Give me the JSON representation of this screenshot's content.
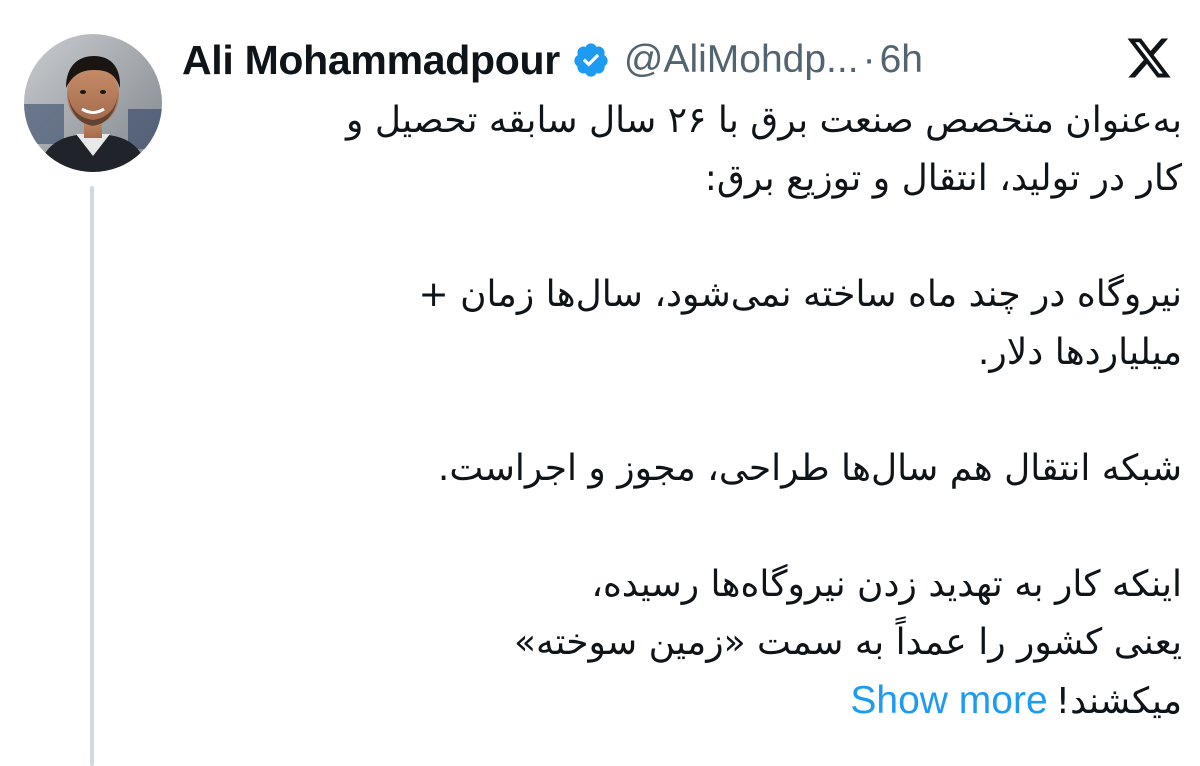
{
  "author": {
    "name": "Ali Mohammadpour",
    "handle": "@AliMohdp...",
    "separator": "·",
    "time": "6h",
    "verified_icon": "verified-badge-icon",
    "verified_color": "#1d9bf0"
  },
  "platform": {
    "logo": "x-logo-icon"
  },
  "tweet": {
    "paragraphs": [
      {
        "lines": [
          "به‌عنوان متخصص صنعت برق با ۲۶ سال سابقه تحصیل و",
          "کار در تولید، انتقال و توزیع برق:"
        ]
      },
      {
        "lines": [
          "نیروگاه در چند ماه ساخته نمی‌شود، سال‌ها زمان +",
          "میلیاردها دلار."
        ]
      },
      {
        "lines": [
          "شبکه انتقال هم سال‌ها طراحی، مجوز و اجراست."
        ]
      },
      {
        "lines": [
          "اینکه کار به تهدید زدن نیروگاه‌ها رسیده،",
          "یعنی کشور را عمداً به سمت «زمین سوخته»",
          "میکشند!"
        ]
      }
    ],
    "show_more": "Show more"
  },
  "colors": {
    "text": "#0f1419",
    "secondary": "#536471",
    "link": "#1d9bf0",
    "thread_line": "#cfd9de"
  }
}
